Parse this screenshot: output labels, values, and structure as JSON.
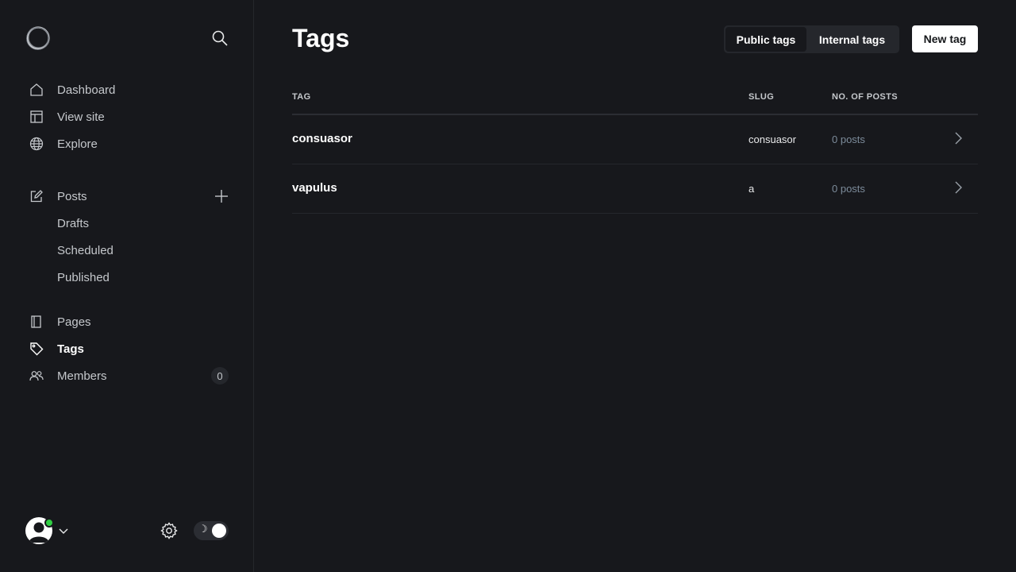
{
  "sidebar": {
    "nav": {
      "dashboard": "Dashboard",
      "view_site": "View site",
      "explore": "Explore",
      "posts": "Posts",
      "drafts": "Drafts",
      "scheduled": "Scheduled",
      "published": "Published",
      "pages": "Pages",
      "tags": "Tags",
      "members": "Members"
    },
    "members_count": "0",
    "theme_toggle_icon": "☽",
    "active_item": "tags"
  },
  "header": {
    "title": "Tags",
    "segment": {
      "public": "Public tags",
      "internal": "Internal tags",
      "selected": "public"
    },
    "new_tag": "New tag"
  },
  "table": {
    "columns": [
      "TAG",
      "SLUG",
      "NO. OF POSTS"
    ],
    "rows": [
      {
        "name": "consuasor",
        "slug": "consuasor",
        "posts": "0 posts"
      },
      {
        "name": "vapulus",
        "slug": "a",
        "posts": "0 posts"
      }
    ]
  },
  "colors": {
    "background": "#17181c",
    "online": "#30cf43",
    "muted": "#7c8b9a"
  }
}
